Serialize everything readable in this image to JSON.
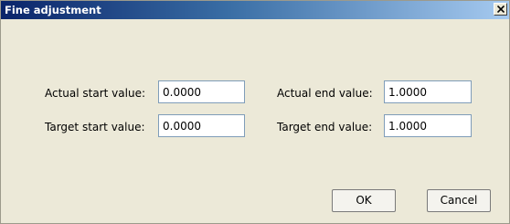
{
  "window": {
    "title": "Fine adjustment"
  },
  "fields": {
    "actual_start": {
      "label": "Actual start value:",
      "value": "0.0000"
    },
    "target_start": {
      "label": "Target start value:",
      "value": "0.0000"
    },
    "actual_end": {
      "label": "Actual end value:",
      "value": "1.0000"
    },
    "target_end": {
      "label": "Target end value:",
      "value": "1.0000"
    }
  },
  "buttons": {
    "ok": "OK",
    "cancel": "Cancel"
  },
  "colors": {
    "titlebar_start": "#0a246a",
    "titlebar_end": "#a6caf0",
    "dialog_background": "#ece9d8"
  },
  "icons": {
    "close": "close-icon"
  }
}
